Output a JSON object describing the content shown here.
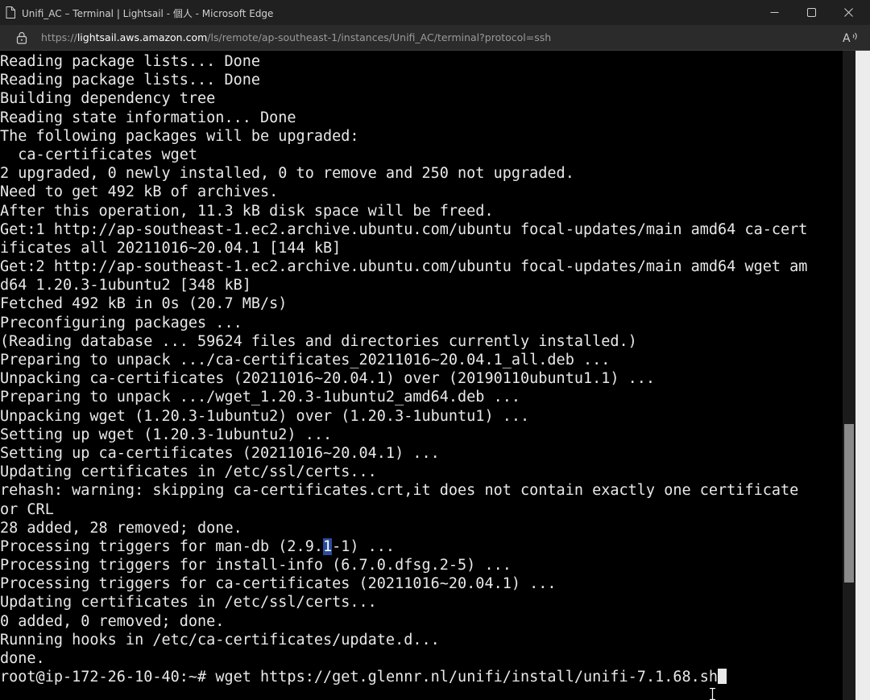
{
  "window": {
    "title": "Unifi_AC – Terminal | Lightsail - 個人 - Microsoft Edge",
    "icons": {
      "page": "page-icon",
      "minimize": "minimize-icon",
      "maximize": "maximize-icon",
      "close": "close-icon"
    }
  },
  "address_bar": {
    "url_prefix": "https://",
    "url_host": "lightsail.aws.amazon.com",
    "url_path": "/ls/remote/ap-southeast-1/instances/Unifi_AC/terminal?protocol=ssh",
    "icons": {
      "lock": "lock-icon",
      "read_aloud": "read-aloud-icon"
    }
  },
  "terminal": {
    "lines": [
      "Reading package lists... Done",
      "Reading package lists... Done",
      "Building dependency tree",
      "Reading state information... Done",
      "The following packages will be upgraded:",
      "  ca-certificates wget",
      "2 upgraded, 0 newly installed, 0 to remove and 250 not upgraded.",
      "Need to get 492 kB of archives.",
      "After this operation, 11.3 kB disk space will be freed.",
      "Get:1 http://ap-southeast-1.ec2.archive.ubuntu.com/ubuntu focal-updates/main amd64 ca-cert",
      "ificates all 20211016~20.04.1 [144 kB]",
      "Get:2 http://ap-southeast-1.ec2.archive.ubuntu.com/ubuntu focal-updates/main amd64 wget am",
      "d64 1.20.3-1ubuntu2 [348 kB]",
      "Fetched 492 kB in 0s (20.7 MB/s)",
      "Preconfiguring packages ...",
      "(Reading database ... 59624 files and directories currently installed.)",
      "Preparing to unpack .../ca-certificates_20211016~20.04.1_all.deb ...",
      "Unpacking ca-certificates (20211016~20.04.1) over (20190110ubuntu1.1) ...",
      "Preparing to unpack .../wget_1.20.3-1ubuntu2_amd64.deb ...",
      "Unpacking wget (1.20.3-1ubuntu2) over (1.20.3-1ubuntu1) ...",
      "Setting up wget (1.20.3-1ubuntu2) ...",
      "Setting up ca-certificates (20211016~20.04.1) ...",
      "Updating certificates in /etc/ssl/certs...",
      "rehash: warning: skipping ca-certificates.crt,it does not contain exactly one certificate",
      "or CRL",
      "28 added, 28 removed; done.",
      "Processing triggers for man-db (2.9.1-1) ...",
      "Processing triggers for install-info (6.7.0.dfsg.2-5) ...",
      "Processing triggers for ca-certificates (20211016~20.04.1) ...",
      "Updating certificates in /etc/ssl/certs...",
      "0 added, 0 removed; done.",
      "Running hooks in /etc/ca-certificates/update.d...",
      "done."
    ],
    "selection": {
      "line_index": 26,
      "before": "Processing triggers for man-db (2.9.",
      "selected": "1",
      "after": "-1) ..."
    },
    "prompt": {
      "text": "root@ip-172-26-10-40:~#",
      "command": " wget https://get.glennr.nl/unifi/install/unifi-7.1.68.sh"
    },
    "colors": {
      "background": "#000000",
      "foreground": "#e8e8e8",
      "selection": "#2a4c99"
    }
  },
  "scrollbar": {
    "position_fraction": 0.76
  },
  "icons": {
    "mouse_cursor": "ibeam-cursor-icon"
  }
}
